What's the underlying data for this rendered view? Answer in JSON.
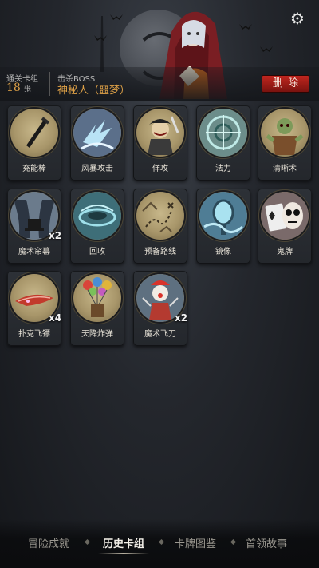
{
  "header": {
    "stat1": {
      "label": "通关卡组",
      "value": "18",
      "unit": "张"
    },
    "stat2": {
      "label": "击杀BOSS",
      "value": "神秘人（噩梦）"
    },
    "delete_label": "删除",
    "settings_icon": "ghost-settings-icon"
  },
  "cards": [
    {
      "label": "充能棒",
      "icon": "wand-icon",
      "multiplier": ""
    },
    {
      "label": "风暴攻击",
      "icon": "lightning-icon",
      "multiplier": ""
    },
    {
      "label": "佯攻",
      "icon": "feint-pirate-icon",
      "multiplier": ""
    },
    {
      "label": "法力",
      "icon": "mana-circle-icon",
      "multiplier": ""
    },
    {
      "label": "清晰术",
      "icon": "zombie-icon",
      "multiplier": ""
    },
    {
      "label": "魔术帘幕",
      "icon": "curtain-icon",
      "multiplier": "x2"
    },
    {
      "label": "回收",
      "icon": "recycle-vortex-icon",
      "multiplier": ""
    },
    {
      "label": "预备路线",
      "icon": "map-route-icon",
      "multiplier": ""
    },
    {
      "label": "镜像",
      "icon": "mirror-icon",
      "multiplier": ""
    },
    {
      "label": "鬼牌",
      "icon": "joker-card-icon",
      "multiplier": ""
    },
    {
      "label": "扑克飞镖",
      "icon": "card-dart-icon",
      "multiplier": "x4"
    },
    {
      "label": "天降炸弹",
      "icon": "balloon-bomb-icon",
      "multiplier": ""
    },
    {
      "label": "魔术飞刀",
      "icon": "clown-knife-icon",
      "multiplier": "x2"
    }
  ],
  "nav": {
    "tabs": [
      {
        "label": "冒险成就",
        "active": false
      },
      {
        "label": "历史卡组",
        "active": true
      },
      {
        "label": "卡牌图鉴",
        "active": false
      },
      {
        "label": "首领故事",
        "active": false
      }
    ]
  },
  "colors": {
    "accent_gold": "#e0a247",
    "delete_red": "#c0261f",
    "card_disc": "#a8966a"
  }
}
